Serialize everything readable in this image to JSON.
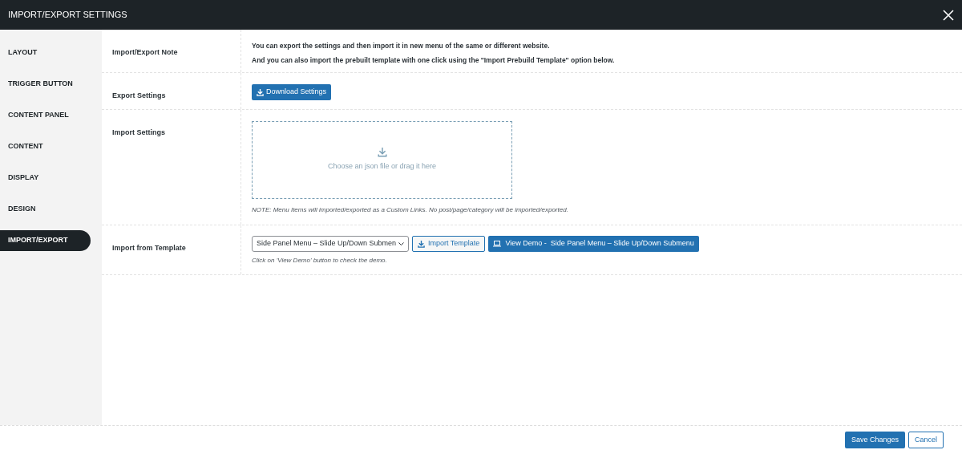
{
  "window": {
    "title": "IMPORT/EXPORT SETTINGS"
  },
  "sidebar": {
    "items": [
      {
        "label": "LAYOUT",
        "selected": false
      },
      {
        "label": "TRIGGER BUTTON",
        "selected": false
      },
      {
        "label": "CONTENT PANEL",
        "selected": false
      },
      {
        "label": "CONTENT",
        "selected": false
      },
      {
        "label": "DISPLAY",
        "selected": false
      },
      {
        "label": "DESIGN",
        "selected": false
      },
      {
        "label": "IMPORT/EXPORT",
        "selected": true
      }
    ]
  },
  "rows": [
    {
      "kind": "note",
      "label": "Import/Export Note",
      "lines": [
        "You can export the settings and then import it in new menu of the same or different website.",
        "And you can also import the prebuilt template with one click using the \"Import Prebuild Template\" option below."
      ]
    },
    {
      "kind": "export",
      "label": "Export Settings",
      "button": "Download Settings"
    },
    {
      "kind": "import",
      "label": "Import Settings",
      "dropzone": "Choose an json file or drag it here",
      "note": "NOTE: Menu Items will imported/exported as a Custom Links. No post/page/category will be imported/exported."
    },
    {
      "kind": "template",
      "label": "Import from Template",
      "select": "Side Panel Menu – Slide Up/Down Submen",
      "import_button": "Import Template",
      "demo_button": "View Demo -  Side Panel Menu – Slide Up/Down Submenu",
      "hint": "Click on 'View Demo' button to check the demo."
    }
  ],
  "footer": {
    "save": "Save Changes",
    "cancel": "Cancel"
  }
}
